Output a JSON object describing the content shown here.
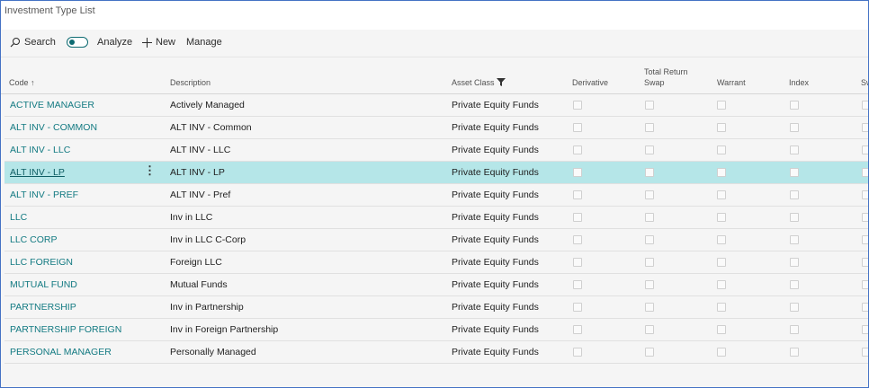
{
  "window": {
    "title": "Investment Type List"
  },
  "actions": {
    "search": "Search",
    "analyze": "Analyze",
    "new": "New",
    "manage": "Manage"
  },
  "columns": {
    "code": "Code",
    "description": "Description",
    "asset_class": "Asset Class",
    "derivative": "Derivative",
    "total_return_swap_line1": "Total Return",
    "total_return_swap_line2": "Swap",
    "warrant": "Warrant",
    "index": "Index",
    "cut_off": "Sw"
  },
  "rows": [
    {
      "code": "ACTIVE MANAGER",
      "description": "Actively Managed",
      "asset_class": "Private Equity Funds"
    },
    {
      "code": "ALT INV - COMMON",
      "description": "ALT INV - Common",
      "asset_class": "Private Equity Funds"
    },
    {
      "code": "ALT INV - LLC",
      "description": "ALT INV - LLC",
      "asset_class": "Private Equity Funds"
    },
    {
      "code": "ALT INV - LP",
      "description": "ALT INV - LP",
      "asset_class": "Private Equity Funds"
    },
    {
      "code": "ALT INV - PREF",
      "description": "ALT INV - Pref",
      "asset_class": "Private Equity Funds"
    },
    {
      "code": "LLC",
      "description": "Inv in LLC",
      "asset_class": "Private Equity Funds"
    },
    {
      "code": "LLC CORP",
      "description": "Inv in LLC C-Corp",
      "asset_class": "Private Equity Funds"
    },
    {
      "code": "LLC FOREIGN",
      "description": "Foreign LLC",
      "asset_class": "Private Equity Funds"
    },
    {
      "code": "MUTUAL FUND",
      "description": "Mutual Funds",
      "asset_class": "Private Equity Funds"
    },
    {
      "code": "PARTNERSHIP",
      "description": "Inv in Partnership",
      "asset_class": "Private Equity Funds"
    },
    {
      "code": "PARTNERSHIP FOREIGN",
      "description": "Inv in Foreign Partnership",
      "asset_class": "Private Equity Funds"
    },
    {
      "code": "PERSONAL MANAGER",
      "description": "Personally Managed",
      "asset_class": "Private Equity Funds"
    }
  ],
  "selected_row": 3,
  "colors": {
    "accent": "#137a82",
    "selected_row": "#b5e6e8",
    "frame_border": "#4472c4"
  }
}
